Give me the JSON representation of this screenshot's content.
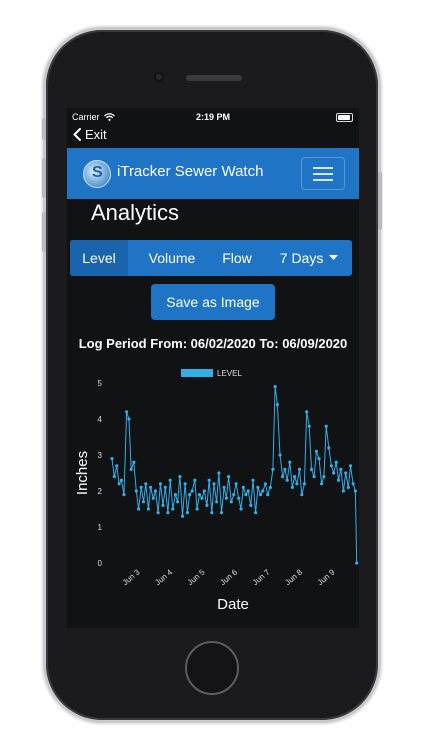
{
  "status_bar": {
    "carrier": "Carrier",
    "time": "2:19 PM"
  },
  "nav": {
    "back_label": "Exit"
  },
  "header": {
    "app_title": "iTracker Sewer Watch",
    "logo_letter": "S"
  },
  "page": {
    "title": "Analytics"
  },
  "tabs": [
    {
      "label": "Level",
      "active": true
    },
    {
      "label": "Volume",
      "active": false
    },
    {
      "label": "Flow",
      "active": false
    }
  ],
  "range_dropdown": {
    "selected": "7 Days"
  },
  "save_button": {
    "label": "Save as Image"
  },
  "log_period": {
    "text": "Log Period From: 06/02/2020 To: 06/09/2020"
  },
  "colors": {
    "accent": "#1f74c6",
    "series": "#33aee8",
    "background": "#111214"
  },
  "chart_data": {
    "type": "line",
    "xlabel": "Date",
    "ylabel": "Inches",
    "ylim": [
      0,
      5
    ],
    "yticks": [
      "0",
      "1",
      "2",
      "3",
      "4",
      "5"
    ],
    "xlim": [
      2.1,
      9.7
    ],
    "xticks": [
      {
        "label": "Jun 3",
        "x": 3
      },
      {
        "label": "Jun 4",
        "x": 4
      },
      {
        "label": "Jun 5",
        "x": 5
      },
      {
        "label": "Jun 6",
        "x": 6
      },
      {
        "label": "Jun 7",
        "x": 7
      },
      {
        "label": "Jun 8",
        "x": 8
      },
      {
        "label": "Jun 9",
        "x": 9
      }
    ],
    "legend_position": "top",
    "grid": false,
    "series": [
      {
        "name": "LEVEL",
        "x": [
          2.13,
          2.2,
          2.28,
          2.35,
          2.42,
          2.5,
          2.58,
          2.65,
          2.72,
          2.8,
          2.88,
          2.95,
          3.03,
          3.1,
          3.17,
          3.25,
          3.32,
          3.4,
          3.47,
          3.55,
          3.62,
          3.7,
          3.77,
          3.85,
          3.92,
          4.0,
          4.08,
          4.15,
          4.22,
          4.3,
          4.38,
          4.45,
          4.52,
          4.6,
          4.68,
          4.75,
          4.82,
          4.9,
          4.97,
          5.05,
          5.12,
          5.2,
          5.27,
          5.35,
          5.42,
          5.5,
          5.58,
          5.65,
          5.72,
          5.8,
          5.88,
          5.95,
          6.03,
          6.1,
          6.17,
          6.25,
          6.32,
          6.4,
          6.47,
          6.55,
          6.62,
          6.7,
          6.77,
          6.85,
          6.92,
          7.0,
          7.08,
          7.15,
          7.22,
          7.3,
          7.38,
          7.45,
          7.52,
          7.6,
          7.68,
          7.75,
          7.82,
          7.9,
          7.97,
          8.05,
          8.12,
          8.2,
          8.27,
          8.35,
          8.42,
          8.5,
          8.58,
          8.65,
          8.72,
          8.8,
          8.88,
          8.95,
          9.03,
          9.1,
          9.17,
          9.25,
          9.32,
          9.4,
          9.47,
          9.55,
          9.62,
          9.66
        ],
        "values": [
          2.9,
          2.4,
          2.7,
          2.2,
          2.3,
          1.9,
          4.2,
          4.0,
          2.6,
          2.8,
          2.0,
          1.5,
          2.1,
          1.7,
          2.2,
          1.5,
          2.1,
          1.8,
          2.0,
          1.4,
          2.2,
          1.6,
          2.1,
          1.4,
          2.3,
          1.5,
          1.9,
          1.7,
          2.4,
          1.3,
          2.2,
          1.4,
          1.9,
          2.0,
          2.3,
          1.5,
          1.9,
          1.8,
          2.0,
          1.6,
          2.3,
          1.4,
          2.2,
          1.7,
          2.5,
          1.4,
          2.1,
          1.8,
          2.4,
          1.7,
          1.9,
          2.2,
          1.8,
          1.5,
          2.1,
          1.9,
          2.0,
          1.6,
          2.3,
          1.4,
          2.1,
          1.9,
          2.0,
          2.2,
          1.9,
          2.1,
          2.6,
          4.9,
          4.4,
          3.0,
          2.4,
          2.6,
          2.3,
          2.8,
          2.1,
          2.4,
          2.2,
          2.6,
          1.9,
          2.2,
          4.2,
          3.8,
          2.6,
          2.4,
          3.1,
          2.9,
          2.2,
          2.4,
          3.8,
          3.2,
          2.7,
          2.5,
          2.8,
          2.3,
          2.6,
          2.0,
          2.5,
          2.1,
          2.7,
          2.2,
          2.0,
          0.0
        ]
      }
    ]
  }
}
